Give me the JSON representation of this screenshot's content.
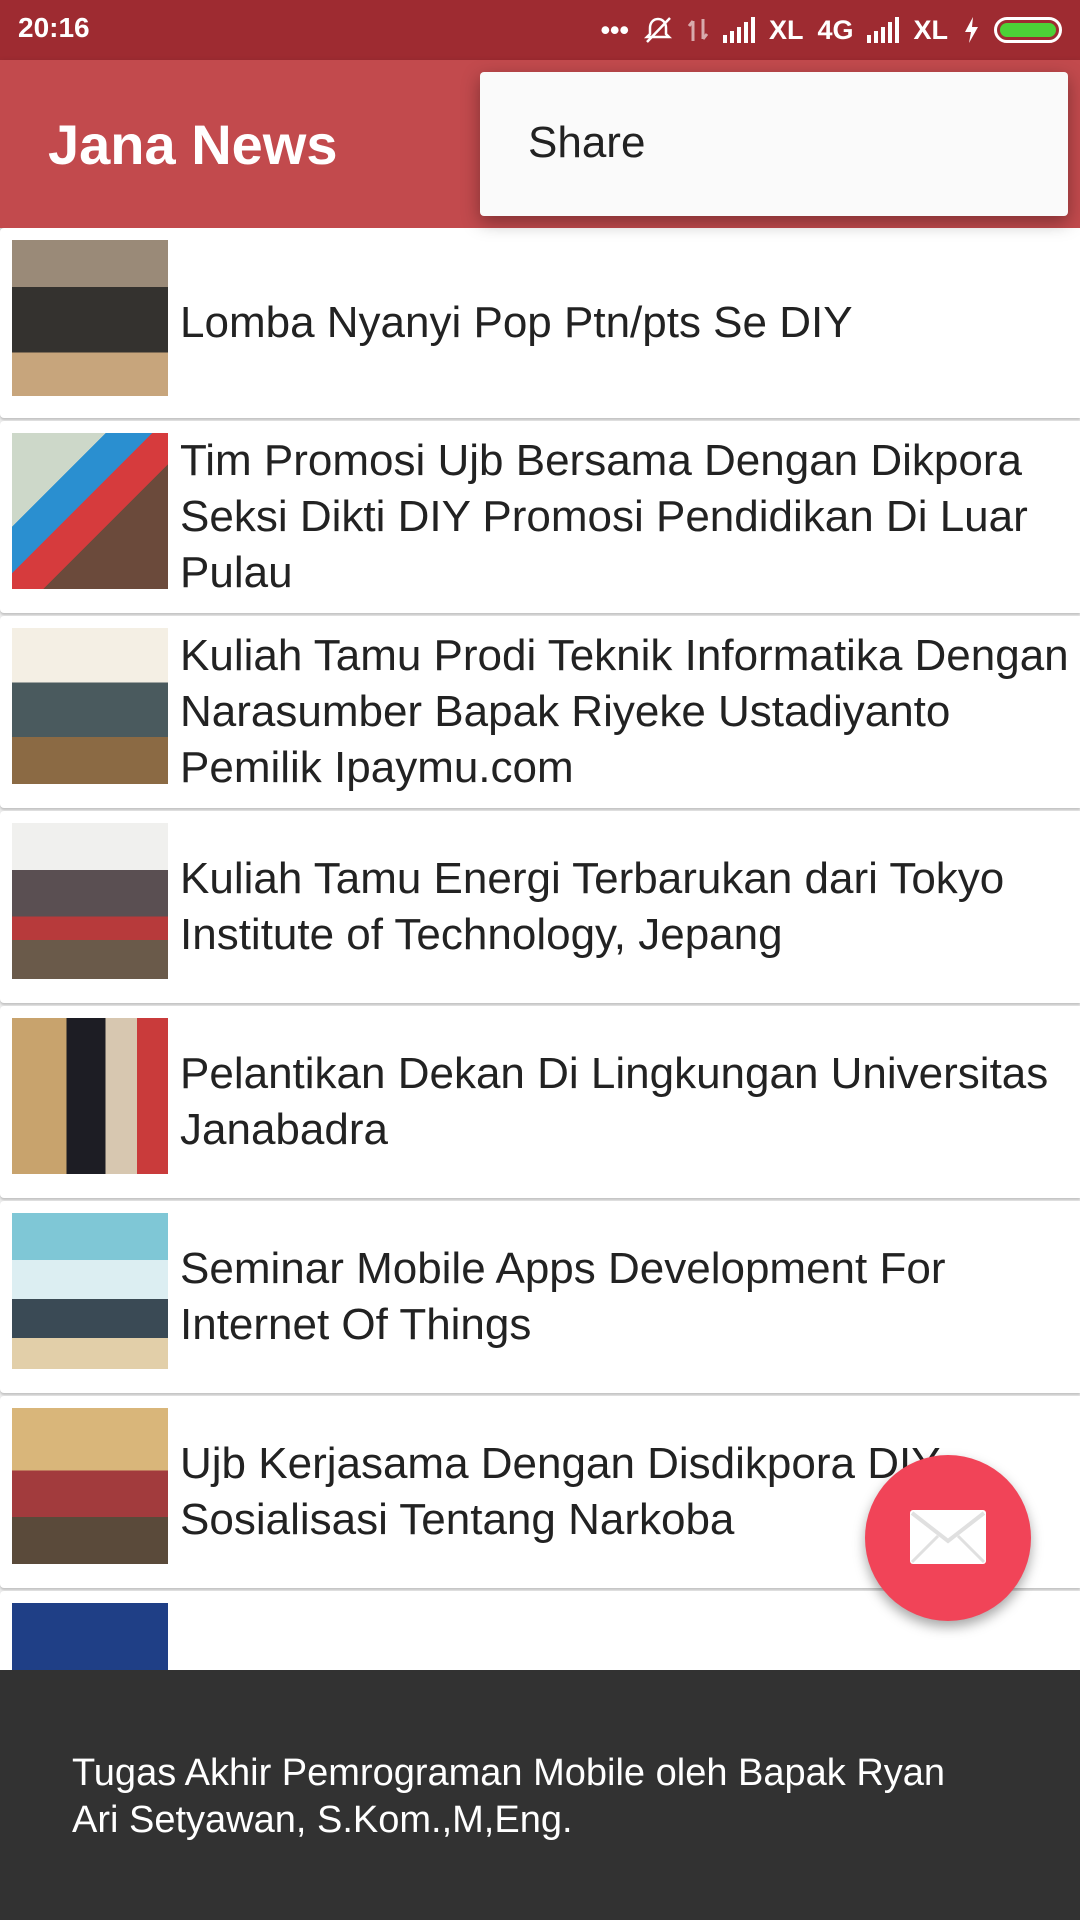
{
  "status_bar": {
    "time": "20:16",
    "carrier_1": "XL",
    "network": "4G",
    "carrier_2": "XL"
  },
  "app_bar": {
    "title": "Jana News"
  },
  "overflow_menu": {
    "items": [
      "Share"
    ]
  },
  "news_list": [
    {
      "title": "Lomba Nyanyi Pop Ptn/pts Se DIY"
    },
    {
      "title": "Tim Promosi Ujb Bersama Dengan Dikpora Seksi Dikti DIY Promosi Pendidikan Di Luar Pulau"
    },
    {
      "title": "Kuliah Tamu Prodi Teknik Informatika Dengan Narasumber Bapak Riyeke Ustadiyanto Pemilik Ipaymu.com"
    },
    {
      "title": "Kuliah Tamu Energi Terbarukan dari Tokyo Institute of Technology, Jepang"
    },
    {
      "title": "Pelantikan Dekan Di Lingkungan Universitas Janabadra"
    },
    {
      "title": "Seminar Mobile Apps Development For Internet Of Things"
    },
    {
      "title": "Ujb Kerjasama Dengan Disdikpora DIY Sosialisasi Tentang Narkoba"
    },
    {
      "title": ""
    }
  ],
  "fab": {
    "icon": "mail-icon"
  },
  "snackbar": {
    "text": "Tugas Akhir Pemrograman Mobile oleh Bapak Ryan Ari Setyawan, S.Kom.,M,Eng."
  },
  "colors": {
    "status_bar": "#9e2b31",
    "app_bar": "#c24a4d",
    "fab": "#f14458",
    "snackbar": "#323232"
  }
}
